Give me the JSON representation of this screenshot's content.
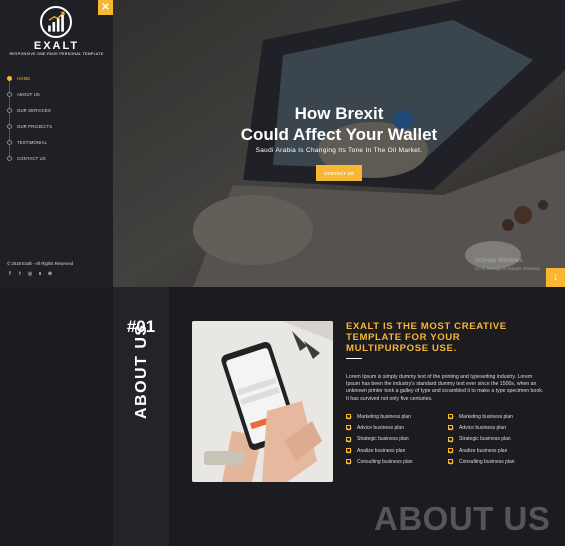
{
  "brand": {
    "name": "EXALT",
    "tagline": "RESPONSIVE ONE PAGE PERSONAL TEMPLATE"
  },
  "nav": {
    "items": [
      {
        "label": "HOME",
        "active": true
      },
      {
        "label": "ABOUT US",
        "active": false
      },
      {
        "label": "OUR SERVICES",
        "active": false
      },
      {
        "label": "OUR PROJECTS",
        "active": false
      },
      {
        "label": "TESTIMONIAL",
        "active": false
      },
      {
        "label": "CONTACT US",
        "active": false
      }
    ]
  },
  "sidebar": {
    "copyright": "© 2018 Exalt - All Rights Reserved",
    "close_icon": "✕",
    "socials": [
      {
        "icon": "facebook-icon",
        "glyph": "f"
      },
      {
        "icon": "twitter-icon",
        "glyph": "t"
      },
      {
        "icon": "instagram-icon",
        "glyph": "◎"
      },
      {
        "icon": "skype-icon",
        "glyph": "s"
      },
      {
        "icon": "dribbble-icon",
        "glyph": "⊛"
      }
    ]
  },
  "hero": {
    "title_line1": "How Brexit",
    "title_line2": "Could Affect Your Wallet",
    "subtitle": "Saudi Arabia Is Changing Its Tone In The Oil Market.",
    "button": "CONTACT US",
    "activate_title": "Activate Windows",
    "activate_sub": "Go to Settings to activate Windows.",
    "down_icon": "↓"
  },
  "about": {
    "number": "#01",
    "vertical_label": "ABOUT US",
    "heading": "EXALT IS THE MOST CREATIVE TEMPLATE FOR YOUR MULTIPURPOSE USE.",
    "body": "Lorem Ipsum is simply dummy text of the printing and typesetting industry. Lorem Ipsum has been the industry's standard dummy text ever since the 1500s, when an unknown printer took a galley of type and scrambled it to make a type specimen book. It has survived not only five centuries.",
    "checks_left": [
      "Marketing business plan",
      "Advice business plan",
      "Strategic business plan",
      "Analize business plan",
      "Consulting business plan"
    ],
    "checks_right": [
      "Marketing business plan",
      "Advice business plan",
      "Strategic business plan",
      "Analize business plan",
      "Consulting business plan"
    ],
    "watermark": "ABOUT US"
  },
  "colors": {
    "accent": "#f7b733",
    "dark": "#1b1b20",
    "sidebar": "#1f2025"
  }
}
